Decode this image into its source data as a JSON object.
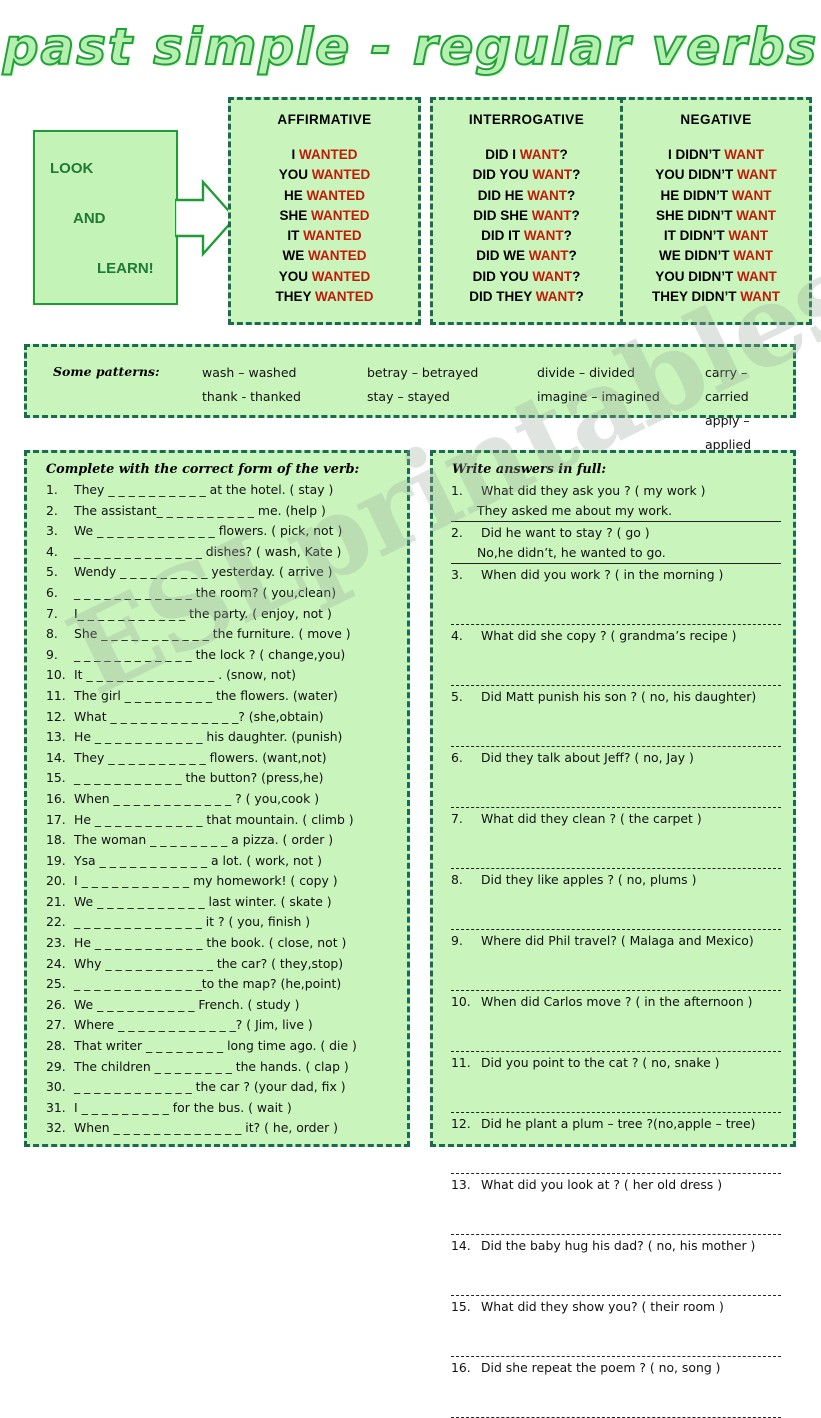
{
  "title": "past simple - regular verbs",
  "colors": {
    "panel_bg": "#c9f5bd",
    "panel_border": "#1b6b52",
    "accent_red": "#c21a08",
    "title_green": "#23a03a",
    "look_border": "#1f9c36"
  },
  "look_box": {
    "line1": "LOOK",
    "line2": "AND",
    "line3": "LEARN!"
  },
  "conjugations": [
    {
      "heading": "AFFIRMATIVE",
      "rows": [
        {
          "subject": "I",
          "verb": "WANTED",
          "tail": ""
        },
        {
          "subject": "YOU",
          "verb": "WANTED",
          "tail": ""
        },
        {
          "subject": "HE",
          "verb": "WANTED",
          "tail": ""
        },
        {
          "subject": "SHE",
          "verb": "WANTED",
          "tail": ""
        },
        {
          "subject": "IT",
          "verb": "WANTED",
          "tail": ""
        },
        {
          "subject": "WE",
          "verb": "WANTED",
          "tail": ""
        },
        {
          "subject": "YOU",
          "verb": "WANTED",
          "tail": ""
        },
        {
          "subject": "THEY",
          "verb": "WANTED",
          "tail": ""
        }
      ]
    },
    {
      "heading": "INTERROGATIVE",
      "rows": [
        {
          "subject": "DID I",
          "verb": "WANT",
          "tail": "?"
        },
        {
          "subject": "DID YOU",
          "verb": "WANT",
          "tail": "?"
        },
        {
          "subject": "DID HE",
          "verb": "WANT",
          "tail": "?"
        },
        {
          "subject": "DID SHE",
          "verb": "WANT",
          "tail": "?"
        },
        {
          "subject": "DID IT",
          "verb": "WANT",
          "tail": "?"
        },
        {
          "subject": "DID WE",
          "verb": "WANT",
          "tail": "?"
        },
        {
          "subject": "DID YOU",
          "verb": "WANT",
          "tail": "?"
        },
        {
          "subject": "DID THEY",
          "verb": "WANT",
          "tail": "?"
        }
      ]
    },
    {
      "heading": "NEGATIVE",
      "rows": [
        {
          "subject": "I DIDN’T",
          "verb": "WANT",
          "tail": ""
        },
        {
          "subject": "YOU DIDN’T",
          "verb": "WANT",
          "tail": ""
        },
        {
          "subject": "HE DIDN’T",
          "verb": "WANT",
          "tail": ""
        },
        {
          "subject": "SHE DIDN’T",
          "verb": "WANT",
          "tail": ""
        },
        {
          "subject": "IT DIDN’T",
          "verb": "WANT",
          "tail": ""
        },
        {
          "subject": "WE DIDN’T",
          "verb": "WANT",
          "tail": ""
        },
        {
          "subject": "YOU DIDN’T",
          "verb": "WANT",
          "tail": ""
        },
        {
          "subject": "THEY DIDN’T",
          "verb": "WANT",
          "tail": ""
        }
      ]
    }
  ],
  "patterns": {
    "label": "Some patterns:",
    "columns": [
      [
        "wash – washed",
        "thank - thanked"
      ],
      [
        "betray – betrayed",
        "stay – stayed"
      ],
      [
        "divide – divided",
        "imagine – imagined"
      ],
      [
        "carry – carried",
        "apply – applied"
      ]
    ]
  },
  "exercise_left": {
    "heading": "Complete with the correct form of the verb:",
    "items": [
      {
        "n": "1.",
        "text": "They  _ _ _ _ _ _ _ _ _ _ at the hotel. ( stay )"
      },
      {
        "n": "2.",
        "text": "The assistant_ _ _ _ _ _ _ _ _ _ me. (help )"
      },
      {
        "n": "3.",
        "text": "We _ _ _ _ _ _ _ _ _ _ _ _ flowers. ( pick, not )"
      },
      {
        "n": "4.",
        "text": "_ _ _ _ _ _ _ _ _ _ _ _ _ dishes? ( wash, Kate )"
      },
      {
        "n": "5.",
        "text": "Wendy  _ _ _ _ _ _ _ _ _ yesterday. ( arrive )"
      },
      {
        "n": "6.",
        "text": "_ _ _ _ _ _ _ _ _ _ _ _ the room? ( you,clean)"
      },
      {
        "n": "7.",
        "text": "I_ _ _ _ _ _ _ _ _ _ _ the party. ( enjoy, not )"
      },
      {
        "n": "8.",
        "text": "She  _ _ _ _ _ _ _ _ _ _ _ the furniture. ( move )"
      },
      {
        "n": "9.",
        "text": "_ _ _ _ _ _ _ _ _ _ _ _ the lock ? ( change,you)"
      },
      {
        "n": "10.",
        "text": "It _ _ _ _ _ _ _ _ _ _ _ _ _ . (snow, not)"
      },
      {
        "n": "11.",
        "text": "The girl _ _ _ _ _ _ _ _ _  the flowers. (water)"
      },
      {
        "n": "12.",
        "text": "What _ _ _ _ _ _ _ _ _ _ _ _ _? (she,obtain)"
      },
      {
        "n": "13.",
        "text": "He _ _ _ _ _ _ _ _ _ _ _  his daughter. (punish)"
      },
      {
        "n": "14.",
        "text": "They _ _ _ _ _ _ _ _ _ _ flowers. (want,not)"
      },
      {
        "n": "15.",
        "text": "_ _ _ _ _ _ _ _ _ _ _  the button? (press,he)"
      },
      {
        "n": "16.",
        "text": "When _ _ _ _ _ _ _ _ _ _ _ _ ? ( you,cook )"
      },
      {
        "n": "17.",
        "text": "He _ _ _ _ _ _ _ _ _ _ _ that mountain. ( climb )"
      },
      {
        "n": "18.",
        "text": "The woman _ _ _ _ _ _ _ _ a pizza. ( order )"
      },
      {
        "n": "19.",
        "text": "Ysa _ _ _ _ _ _ _ _ _ _ _ a lot. ( work, not )"
      },
      {
        "n": "20.",
        "text": "I _ _ _ _ _ _ _ _ _ _ _ my homework! ( copy )"
      },
      {
        "n": "21.",
        "text": "We _ _ _ _ _ _ _ _ _ _ _ last winter. ( skate )"
      },
      {
        "n": "22.",
        "text": "_ _ _ _ _ _ _ _ _ _ _ _ _ it ? ( you, finish )"
      },
      {
        "n": "23.",
        "text": "He _ _ _ _ _ _ _ _ _ _ _ the book. ( close, not )"
      },
      {
        "n": "24.",
        "text": "Why _ _ _ _ _ _ _ _ _ _ _ the car? ( they,stop)"
      },
      {
        "n": "25.",
        "text": "_ _ _ _ _ _ _ _ _ _ _ _ _to the map? (he,point)"
      },
      {
        "n": "26.",
        "text": "We _ _ _ _ _ _ _ _ _ _ French. ( study )"
      },
      {
        "n": "27.",
        "text": "Where _ _ _ _ _ _ _ _ _ _ _ _? ( Jim, live )"
      },
      {
        "n": "28.",
        "text": "That writer _ _ _ _ _ _ _ _ long time ago. ( die )"
      },
      {
        "n": "29.",
        "text": "The children _ _ _ _ _ _ _ _  the hands. ( clap )"
      },
      {
        "n": "30.",
        "text": "_ _ _ _ _ _ _ _ _ _ _ _ the car ? (your dad, fix )"
      },
      {
        "n": "31.",
        "text": "I _ _ _ _ _ _ _ _ _  for the bus. ( wait )"
      },
      {
        "n": "32.",
        "text": "When _ _ _ _ _ _ _ _ _ _ _ _ _ it? ( he, order )"
      }
    ]
  },
  "exercise_right": {
    "heading": "Write answers in full:",
    "items": [
      {
        "n": "1.",
        "q": "What did they ask you ?  ( my work )",
        "a": "They asked me about my work."
      },
      {
        "n": "2.",
        "q": "Did he want to stay ?  ( go )",
        "a": "No,he didn’t, he wanted to go."
      },
      {
        "n": "3.",
        "q": "When did you work ? ( in the morning )",
        "a": ""
      },
      {
        "n": "4.",
        "q": "What did she copy ?  ( grandma’s recipe )",
        "a": ""
      },
      {
        "n": "5.",
        "q": "Did Matt punish his son ? ( no, his daughter)",
        "a": ""
      },
      {
        "n": "6.",
        "q": "Did they talk about Jeff?  ( no, Jay )",
        "a": ""
      },
      {
        "n": "7.",
        "q": "What did they clean ? ( the carpet )",
        "a": ""
      },
      {
        "n": "8.",
        "q": "Did they like apples ?  ( no, plums )",
        "a": ""
      },
      {
        "n": "9.",
        "q": "Where did Phil travel? ( Malaga and Mexico)",
        "a": ""
      },
      {
        "n": "10.",
        "q": "When did Carlos move ? ( in the afternoon )",
        "a": ""
      },
      {
        "n": "11.",
        "q": "Did you point to the cat ?  (  no, snake )",
        "a": ""
      },
      {
        "n": "12.",
        "q": "Did he plant a plum – tree ?(no,apple – tree)",
        "a": ""
      },
      {
        "n": "13.",
        "q": "What did you look at ? ( her old dress )",
        "a": ""
      },
      {
        "n": "14.",
        "q": "Did the baby hug his dad? ( no, his mother )",
        "a": ""
      },
      {
        "n": "15.",
        "q": "What did they show you? ( their room )",
        "a": ""
      },
      {
        "n": "16.",
        "q": "Did she repeat the poem ? ( no, song )",
        "a": ""
      }
    ]
  },
  "watermark": "ESLprintables.com"
}
